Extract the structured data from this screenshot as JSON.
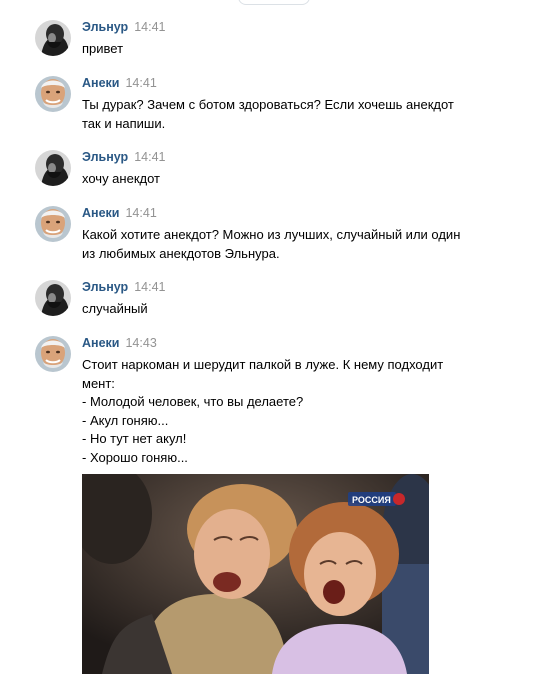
{
  "messages": [
    {
      "author": "Эльнур",
      "time": "14:41",
      "avatar": "man-beard-avatar",
      "lines": [
        "привет"
      ]
    },
    {
      "author": "Анеки",
      "time": "14:41",
      "avatar": "old-man-smiling-avatar",
      "lines": [
        "Ты дурак? Зачем с ботом здороваться? Если хочешь анекдот",
        "так и напиши."
      ]
    },
    {
      "author": "Эльнур",
      "time": "14:41",
      "avatar": "man-beard-avatar",
      "lines": [
        "хочу анекдот"
      ]
    },
    {
      "author": "Анеки",
      "time": "14:41",
      "avatar": "old-man-smiling-avatar",
      "lines": [
        "Какой хотите анекдот? Можно из лучших, случайный или один",
        "из любимых анекдотов Эльнура."
      ]
    },
    {
      "author": "Эльнур",
      "time": "14:41",
      "avatar": "man-beard-avatar",
      "lines": [
        "случайный"
      ]
    },
    {
      "author": "Анеки",
      "time": "14:43",
      "avatar": "old-man-smiling-avatar",
      "lines": [
        "Стоит наркоман и шерудит палкой в луже. К нему подходит",
        "мент:",
        "- Молодой человек, что вы делаете?",
        "- Акул гоняю...",
        "- Но тут нет акул!",
        "- Хорошо гоняю..."
      ]
    }
  ],
  "attachment": {
    "type": "photo",
    "subject": "two-women-laughing-in-audience",
    "watermark": "РОССИЯ"
  },
  "colors": {
    "author": "#2a5885",
    "time": "#939393",
    "text": "#000000",
    "background": "#ffffff"
  }
}
